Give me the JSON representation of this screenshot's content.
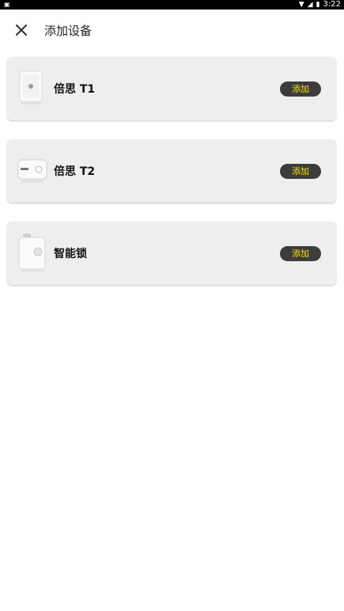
{
  "status_bar": {
    "notification_icon": "android-notification-icon",
    "time": "3:22",
    "icons": [
      "wifi-icon",
      "signal-icon",
      "battery-icon"
    ]
  },
  "header": {
    "title": "添加设备",
    "close_icon": "close-icon"
  },
  "devices": [
    {
      "name": "倍思 T1",
      "add_label": "添加",
      "icon": "t1-device-image"
    },
    {
      "name": "倍思 T2",
      "add_label": "添加",
      "icon": "t2-device-image"
    },
    {
      "name": "智能锁",
      "add_label": "添加",
      "icon": "smart-lock-device-image"
    }
  ],
  "colors": {
    "card_bg": "#eeeeee",
    "button_bg": "#3c3c3c",
    "button_text": "#f5e100"
  }
}
